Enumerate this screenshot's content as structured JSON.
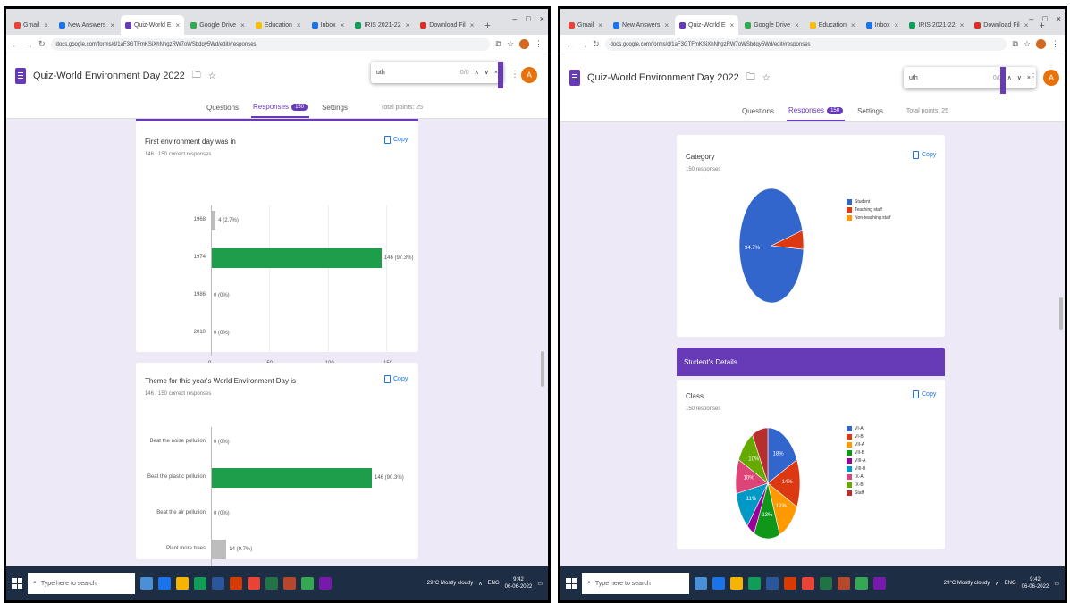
{
  "browser": {
    "tabs_left": [
      "Gmail",
      "New Answers",
      "Quiz-World E",
      "Google Drive",
      "Education",
      "Inbox",
      "IRIS 2021-22",
      "Download Fil"
    ],
    "tabs_right": [
      "Gmail",
      "New Answers",
      "Quiz-World E",
      "Google Drive",
      "Education",
      "Inbox",
      "IRIS 2021-22",
      "Download Fil"
    ],
    "url": "docs.google.com/forms/d/1aF3GTFmKSiXhNhgzRW7oWSbdqy5Wd/edit#responses",
    "new_tab_symbol": "+",
    "window_controls": [
      "–",
      "□",
      "×"
    ]
  },
  "form": {
    "title": "Quiz-World Environment Day 2022",
    "tabs": {
      "questions": "Questions",
      "responses": "Responses",
      "settings": "Settings"
    },
    "response_badge": "150",
    "total_points": "Total points: 25",
    "find": {
      "query": "uth",
      "count": "0/0"
    }
  },
  "left_cards": [
    {
      "title": "First environment day was in",
      "subtitle": "146 / 150 correct responses",
      "copy_label": "Copy"
    },
    {
      "title": "Theme for this year's World Environment Day is",
      "subtitle": "146 / 150 correct responses",
      "copy_label": "Copy"
    }
  ],
  "right_cards": [
    {
      "title": "Category",
      "subtitle": "150 responses",
      "copy_label": "Copy"
    },
    {
      "title": "Class",
      "subtitle": "150 responses",
      "copy_label": "Copy"
    }
  ],
  "section_header": "Student's Details",
  "chart_data": [
    {
      "type": "bar",
      "orientation": "horizontal",
      "title": "First environment day was in",
      "categories": [
        "1968",
        "1974",
        "1986",
        "2010"
      ],
      "values": [
        4,
        146,
        0,
        0
      ],
      "value_labels": [
        "4 (2.7%)",
        "146 (97.3%)",
        "0 (0%)",
        "0 (0%)"
      ],
      "correct_index": 1,
      "xticks": [
        "0",
        "50",
        "100",
        "150"
      ],
      "xlim": [
        0,
        150
      ],
      "colors": {
        "correct": "#1e9e4a",
        "incorrect": "#bdbdbd"
      }
    },
    {
      "type": "bar",
      "orientation": "horizontal",
      "title": "Theme for this year's World Environment Day is",
      "categories": [
        "Beat the noise pollution",
        "Beat the plastic pollution",
        "Beat the air pollution",
        "Plant more trees"
      ],
      "values": [
        0,
        146,
        0,
        14
      ],
      "value_labels": [
        "0 (0%)",
        "146 (90.3%)",
        "0 (0%)",
        "14 (9.7%)"
      ],
      "correct_index": 1,
      "colors": {
        "correct": "#1e9e4a",
        "incorrect": "#bdbdbd"
      }
    },
    {
      "type": "pie",
      "title": "Category",
      "labels": [
        "Student",
        "Teaching staff",
        "Non-teaching staff"
      ],
      "values": [
        94.7,
        5.3,
        0
      ],
      "slice_labels": [
        "94.7%"
      ],
      "colors": [
        "#3366cc",
        "#dc3912",
        "#ff9900"
      ]
    },
    {
      "type": "pie",
      "title": "Class",
      "labels": [
        "VI-A",
        "VI-B",
        "VII-A",
        "VII-B",
        "VIII-A",
        "VIII-B",
        "IX-A",
        "IX-B",
        "Staff"
      ],
      "values": [
        18,
        14,
        12,
        13,
        4,
        11,
        10,
        10,
        8
      ],
      "slice_labels": [
        "18%",
        "14%",
        "12%",
        "13%",
        "11%",
        "10%",
        "10%"
      ],
      "colors": [
        "#3366cc",
        "#dc3912",
        "#ff9900",
        "#109618",
        "#990099",
        "#0099c6",
        "#dd4477",
        "#66aa00",
        "#b82e2e"
      ]
    }
  ],
  "taskbar": {
    "search_placeholder": "Type here to search",
    "weather": "29°C Mostly cloudy",
    "lang": "ENG",
    "time": "9:42",
    "date": "06-06-2022"
  }
}
